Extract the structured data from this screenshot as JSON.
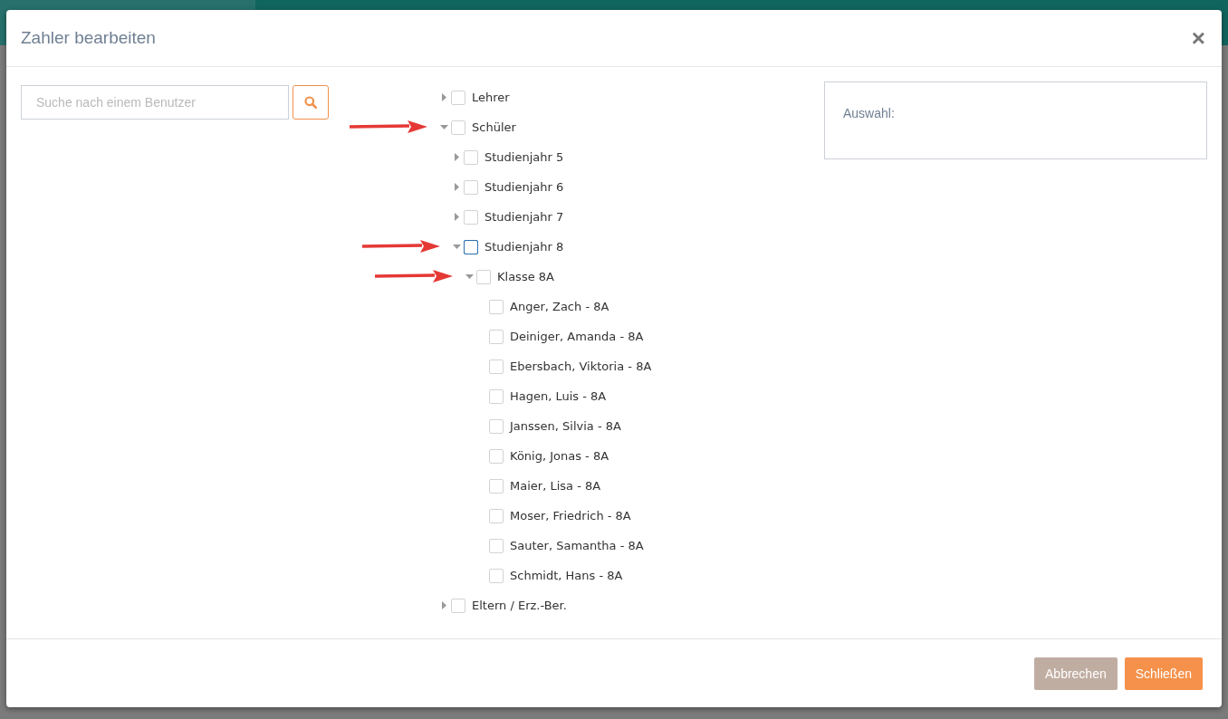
{
  "dialog": {
    "title": "Zahler bearbeiten",
    "close": "×"
  },
  "search": {
    "placeholder": "Suche nach einem Benutzer"
  },
  "tree": [
    {
      "label": "Lehrer",
      "kind": "group",
      "expanded": false,
      "checked": false,
      "focused": false,
      "annotated": false
    },
    {
      "label": "Schüler",
      "kind": "group",
      "expanded": true,
      "checked": false,
      "focused": false,
      "annotated": true,
      "children": [
        {
          "label": "Studienjahr 5",
          "kind": "group",
          "expanded": false,
          "checked": false,
          "focused": false,
          "annotated": false
        },
        {
          "label": "Studienjahr 6",
          "kind": "group",
          "expanded": false,
          "checked": false,
          "focused": false,
          "annotated": false
        },
        {
          "label": "Studienjahr 7",
          "kind": "group",
          "expanded": false,
          "checked": false,
          "focused": false,
          "annotated": false
        },
        {
          "label": "Studienjahr 8",
          "kind": "group",
          "expanded": true,
          "checked": false,
          "focused": true,
          "annotated": true,
          "children": [
            {
              "label": "Klasse 8A",
              "kind": "group",
              "expanded": true,
              "checked": false,
              "focused": false,
              "annotated": true,
              "children": [
                {
                  "label": "Anger, Zach - 8A",
                  "kind": "leaf",
                  "checked": false,
                  "focused": false,
                  "annotated": false
                },
                {
                  "label": "Deiniger, Amanda - 8A",
                  "kind": "leaf",
                  "checked": false,
                  "focused": false,
                  "annotated": false
                },
                {
                  "label": "Ebersbach, Viktoria - 8A",
                  "kind": "leaf",
                  "checked": false,
                  "focused": false,
                  "annotated": false
                },
                {
                  "label": "Hagen, Luis - 8A",
                  "kind": "leaf",
                  "checked": false,
                  "focused": false,
                  "annotated": false
                },
                {
                  "label": "Janssen, Silvia - 8A",
                  "kind": "leaf",
                  "checked": false,
                  "focused": false,
                  "annotated": false
                },
                {
                  "label": "König, Jonas - 8A",
                  "kind": "leaf",
                  "checked": false,
                  "focused": false,
                  "annotated": false
                },
                {
                  "label": "Maier, Lisa - 8A",
                  "kind": "leaf",
                  "checked": false,
                  "focused": false,
                  "annotated": false
                },
                {
                  "label": "Moser, Friedrich - 8A",
                  "kind": "leaf",
                  "checked": false,
                  "focused": false,
                  "annotated": false
                },
                {
                  "label": "Sauter, Samantha - 8A",
                  "kind": "leaf",
                  "checked": false,
                  "focused": false,
                  "annotated": false
                },
                {
                  "label": "Schmidt, Hans - 8A",
                  "kind": "leaf",
                  "checked": false,
                  "focused": false,
                  "annotated": false
                }
              ]
            }
          ]
        }
      ]
    },
    {
      "label": "Eltern / Erz.-Ber.",
      "kind": "group",
      "expanded": false,
      "checked": false,
      "focused": false,
      "annotated": false
    }
  ],
  "selection": {
    "label": "Auswahl:"
  },
  "buttons": [
    {
      "label": "Abbrechen",
      "kind": "secondary"
    },
    {
      "label": "Schließen",
      "kind": "primary"
    }
  ]
}
